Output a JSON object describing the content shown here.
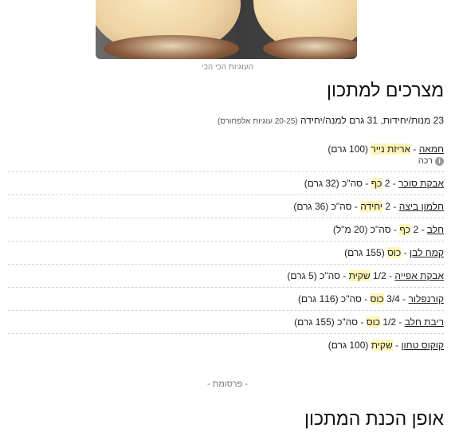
{
  "photo_caption": "העוגיות הכי הכי",
  "title": "מצרכים למתכון",
  "servings": {
    "main": "23 מנות/יחידות, 31 גרם למנה/יחידה",
    "note": "(20-25 עוגיות אלפחורס)"
  },
  "ingredients": [
    {
      "name": "חמאה",
      "sep": " - ",
      "unit": "אריזת נייר",
      "detail": " (100 גרם)",
      "sub": "רכה",
      "info_icon": "info-icon"
    },
    {
      "name": "אבקת סוכר",
      "sep": " - 2 ",
      "unit": "כף",
      "detail": " - סה\"כ (32 גרם)"
    },
    {
      "name": "חלמון ביצה",
      "sep": " - 2 ",
      "unit": "יחידה",
      "detail": " - סה\"כ (36 גרם)"
    },
    {
      "name": "חלב",
      "sep": " - 2 ",
      "unit": "כף",
      "detail": " - סה\"כ (20 מ\"ל)"
    },
    {
      "name": "קמח לבן",
      "sep": " - ",
      "unit": "כוס",
      "detail": " (155 גרם)"
    },
    {
      "name": "אבקת אפייה",
      "sep": " - 1/2 ",
      "unit": "שקית",
      "detail": " - סה\"כ (5 גרם)"
    },
    {
      "name": "קורנפלור",
      "sep": " - 3/4 ",
      "unit": "כוס",
      "detail": " - סה\"כ (116 גרם)"
    },
    {
      "name": "ריבת חלב",
      "sep": " - 1/2 ",
      "unit": "כוס",
      "detail": " - סה\"כ (155 גרם)"
    },
    {
      "name": "קוקוס טחון",
      "sep": " - ",
      "unit": "שקית",
      "detail": " (100 גרם)"
    }
  ],
  "ads_label": "- פרסומת -",
  "method_title": "אופן הכנת המתכון",
  "colors": {
    "highlight": "#fff6b8",
    "divider": "#d2d2d2"
  }
}
